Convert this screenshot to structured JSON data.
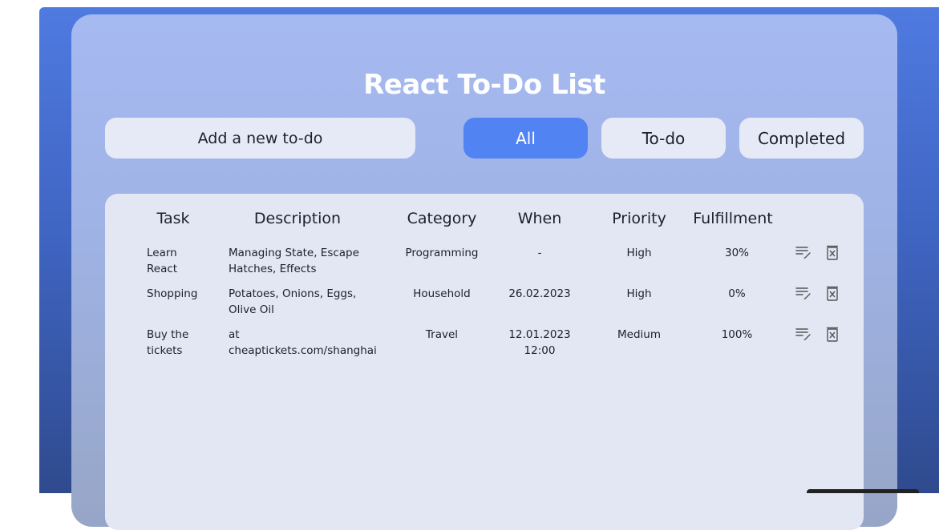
{
  "app": {
    "title": "React To-Do List"
  },
  "add_todo": {
    "placeholder": "Add a new to-do",
    "value": ""
  },
  "filters": [
    {
      "label": "All",
      "active": true
    },
    {
      "label": "To-do",
      "active": false
    },
    {
      "label": "Completed",
      "active": false
    }
  ],
  "table": {
    "headers": [
      "Task",
      "Description",
      "Category",
      "When",
      "Priority",
      "Fulfillment"
    ],
    "rows": [
      {
        "task": "Learn React",
        "description": "Managing State, Escape Hatches, Effects",
        "category": "Programming",
        "when": "-",
        "priority": "High",
        "fulfillment": "30%"
      },
      {
        "task": "Shopping",
        "description": "Potatoes, Onions, Eggs, Olive Oil",
        "category": "Household",
        "when": "26.02.2023",
        "priority": "High",
        "fulfillment": "0%"
      },
      {
        "task": "Buy the tickets",
        "description": "at cheaptickets.com/shanghai",
        "category": "Travel",
        "when": "12.01.2023 12:00",
        "priority": "Medium",
        "fulfillment": "100%"
      }
    ],
    "row_actions": [
      "edit-icon",
      "delete-icon"
    ]
  },
  "colors": {
    "background_top": "#4f7ae0",
    "background_bottom": "#2f4a8e",
    "panel": "#a6baf2",
    "pill": "#e6eaf7",
    "accent": "#5183f3",
    "table_card": "#e3e7f4",
    "text": "#1c1f2e"
  }
}
